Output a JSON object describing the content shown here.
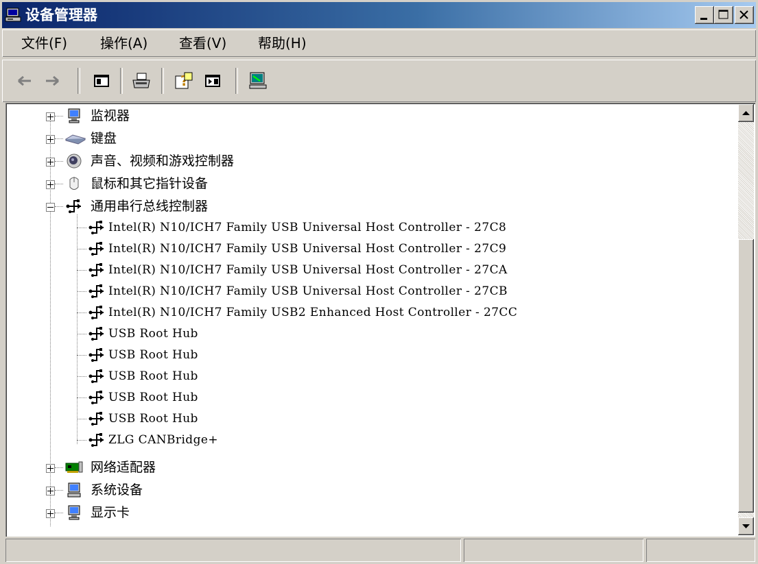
{
  "window": {
    "title": "设备管理器"
  },
  "menu": [
    {
      "label": "文件(F)"
    },
    {
      "label": "操作(A)"
    },
    {
      "label": "查看(V)"
    },
    {
      "label": "帮助(H)"
    }
  ],
  "toolbar": {
    "icons": [
      "back-arrow-icon",
      "forward-arrow-icon",
      "show-hide-console-tree-icon",
      "print-icon",
      "help-icon",
      "properties-icon",
      "scan-hardware-icon"
    ]
  },
  "tree": {
    "categories": [
      {
        "label": "监视器",
        "icon": "monitor-icon",
        "expanded": false
      },
      {
        "label": "键盘",
        "icon": "keyboard-icon",
        "expanded": false
      },
      {
        "label": "声音、视频和游戏控制器",
        "icon": "speaker-icon",
        "expanded": false
      },
      {
        "label": "鼠标和其它指针设备",
        "icon": "mouse-icon",
        "expanded": false
      },
      {
        "label": "通用串行总线控制器",
        "icon": "usb-icon",
        "expanded": true
      },
      {
        "label": "网络适配器",
        "icon": "network-card-icon",
        "expanded": false
      },
      {
        "label": "系统设备",
        "icon": "computer-icon",
        "expanded": false
      },
      {
        "label": "显示卡",
        "icon": "monitor-icon",
        "expanded": false
      }
    ],
    "usb_devices": [
      {
        "label": "Intel(R) N10/ICH7 Family USB Universal Host Controller - 27C8"
      },
      {
        "label": "Intel(R) N10/ICH7 Family USB Universal Host Controller - 27C9"
      },
      {
        "label": "Intel(R) N10/ICH7 Family USB Universal Host Controller - 27CA"
      },
      {
        "label": "Intel(R) N10/ICH7 Family USB Universal Host Controller - 27CB"
      },
      {
        "label": "Intel(R) N10/ICH7 Family USB2 Enhanced Host Controller - 27CC"
      },
      {
        "label": "USB Root Hub"
      },
      {
        "label": "USB Root Hub"
      },
      {
        "label": "USB Root Hub"
      },
      {
        "label": "USB Root Hub"
      },
      {
        "label": "USB Root Hub"
      },
      {
        "label": "ZLG CANBridge+"
      }
    ]
  },
  "statusbar": {
    "cells": [
      "",
      "",
      ""
    ]
  }
}
